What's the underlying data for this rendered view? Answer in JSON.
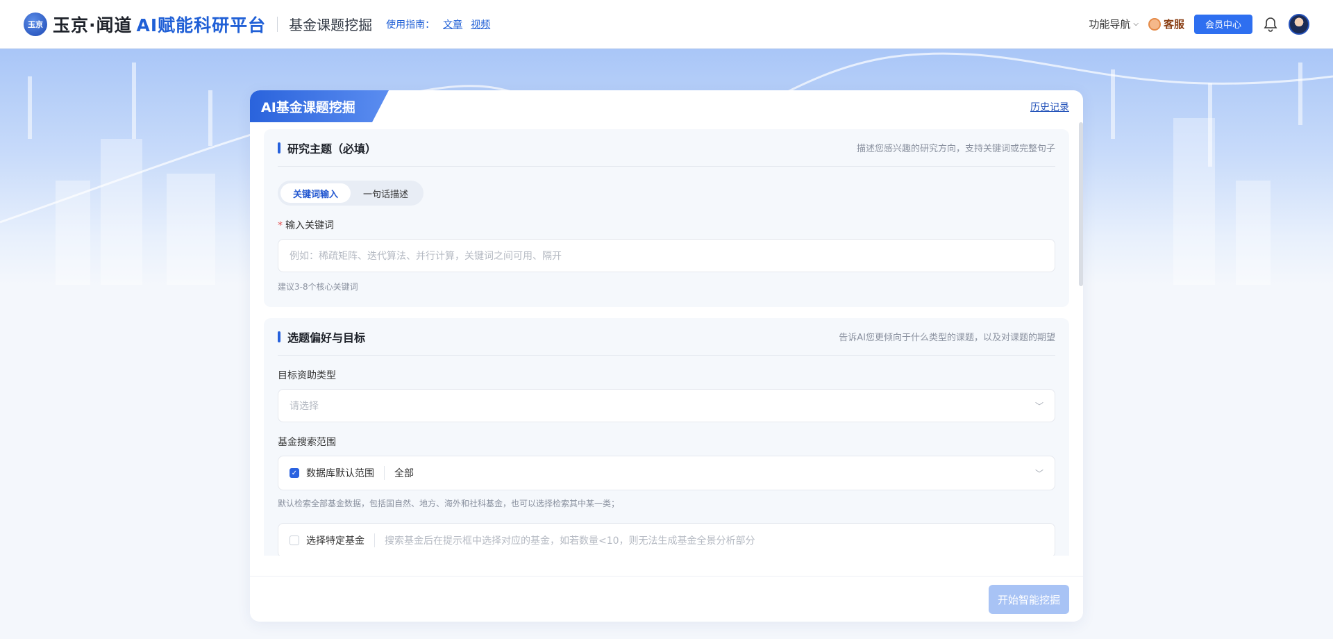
{
  "header": {
    "logo_text": "玉京",
    "brand_cn": "玉京·闻道",
    "brand_ai": "AI赋能科研平台",
    "page_name": "基金课题挖掘",
    "guide_label": "使用指南：",
    "guide_links": [
      "文章",
      "视频"
    ],
    "nav_menu": "功能导航",
    "kefu": "客服",
    "vip_button": "会员中心"
  },
  "card": {
    "title": "AI基金课题挖掘",
    "history_link": "历史记录",
    "start_button": "开始智能挖掘"
  },
  "section_topic": {
    "title": "研究主题（必填）",
    "desc": "描述您感兴趣的研究方向，支持关键词或完整句子",
    "tabs": [
      "关键词输入",
      "一句话描述"
    ],
    "active_tab": "关键词输入",
    "required_mark": "*",
    "field_label": "输入关键词",
    "placeholder": "例如：稀疏矩阵、迭代算法、并行计算，关键词之间可用、隔开",
    "hint": "建议3-8个核心关键词"
  },
  "section_pref": {
    "title": "选题偏好与目标",
    "desc": "告诉AI您更倾向于什么类型的课题，以及对课题的期望",
    "funding_label": "目标资助类型",
    "funding_placeholder": "请选择",
    "scope_label": "基金搜索范围",
    "scope_default_label": "数据库默认范围",
    "scope_default_checked": true,
    "scope_default_value": "全部",
    "scope_note": "默认检索全部基金数据，包括国自然、地方、海外和社科基金，也可以选择检索其中某一类；",
    "scope_specific_label": "选择特定基金",
    "scope_specific_checked": false,
    "scope_specific_placeholder": "搜索基金后在提示框中选择对应的基金，如若数量<10，则无法生成基金全景分析部分"
  }
}
